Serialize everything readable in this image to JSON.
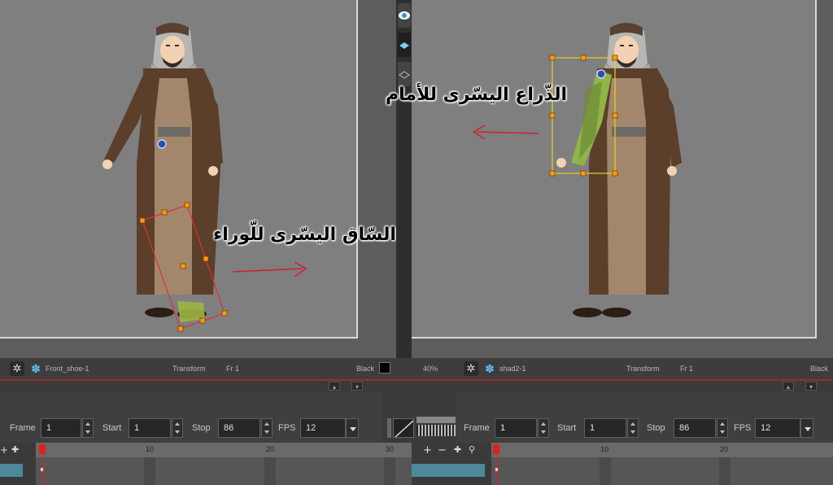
{
  "left_panel": {
    "annotation": "السّاق اليسّرى للّوراء",
    "status": {
      "layer": "Front_shoe-1",
      "tool": "Transform",
      "frame": "Fr 1",
      "color": "Black",
      "zoom": ""
    },
    "playback": {
      "frame_label": "Frame",
      "frame": "1",
      "start_label": "Start",
      "start": "1",
      "stop_label": "Stop",
      "stop": "86",
      "fps_label": "FPS",
      "fps": "12"
    },
    "ruler": [
      "10",
      "20",
      "30"
    ]
  },
  "right_panel": {
    "annotation": "الذّراع اليسّرى للأمام",
    "status": {
      "zoom": "40%",
      "layer": "shad2-1",
      "tool": "Transform",
      "frame": "Fr 1",
      "color": "Black"
    },
    "playback": {
      "frame_label": "Frame",
      "frame": "1",
      "start_label": "Start",
      "start": "1",
      "stop_label": "Stop",
      "stop": "86",
      "fps_label": "FPS",
      "fps": "12"
    },
    "ruler": [
      "10",
      "20"
    ]
  },
  "timeline_tools": {
    "add": "+",
    "remove": "−"
  },
  "colors": {
    "accent_red": "#e02020",
    "selection_red": "#e03030",
    "selection_yellow": "#e8d020",
    "robe_brown": "#5a3d28",
    "robe_inner": "#a08468"
  }
}
